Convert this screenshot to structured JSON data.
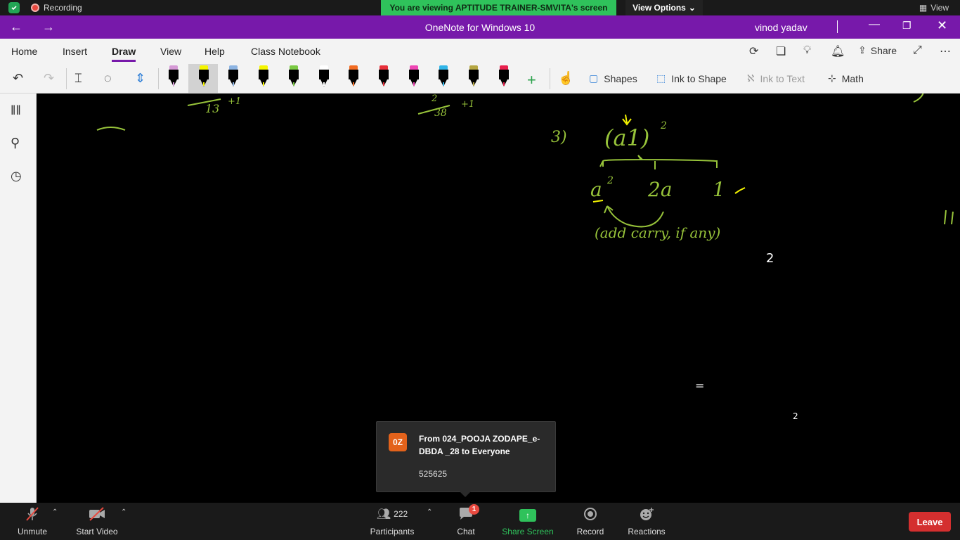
{
  "zoom": {
    "recording_label": "Recording",
    "viewing_banner": "You are viewing APTITUDE TRAINER-SMVITA's screen",
    "view_options_label": "View Options",
    "view_label": "View"
  },
  "titlebar": {
    "title": "OneNote for Windows 10",
    "user": "vinod yadav"
  },
  "menu": {
    "tabs": [
      {
        "label": "Home"
      },
      {
        "label": "Insert"
      },
      {
        "label": "Draw"
      },
      {
        "label": "View"
      },
      {
        "label": "Help"
      },
      {
        "label": "Class Notebook"
      }
    ],
    "active_tab": "Draw",
    "share_label": "Share"
  },
  "ribbon": {
    "shapes_label": "Shapes",
    "ink_to_shape_label": "Ink to Shape",
    "ink_to_text_label": "Ink to Text",
    "math_label": "Math",
    "pens": [
      {
        "color": "#d69ad6"
      },
      {
        "color": "#f5f500"
      },
      {
        "color": "#8db4e2"
      },
      {
        "color": "#f5f500"
      },
      {
        "color": "#7ac943"
      },
      {
        "color": "#ffffff"
      },
      {
        "color": "#f26b21"
      },
      {
        "color": "#e8303a"
      },
      {
        "color": "#ef46b4"
      },
      {
        "color": "#31b5e8"
      },
      {
        "color": "#b5a642"
      },
      {
        "color": "#e8204d"
      }
    ]
  },
  "canvas": {
    "ink": {
      "frac1_num": "13",
      "frac1_plus": "+1",
      "frac2_num": "2",
      "frac2_den": "38",
      "frac2_plus": "+1",
      "step": "3)",
      "expr_base": "(a1)",
      "expr_exp": "2",
      "a_sq_base": "a",
      "a_sq_exp": "2",
      "two_a": "2a",
      "one": "1",
      "note": "(add carry, if any)",
      "white_two": "2",
      "white_equals": "=",
      "white_two_small": "2"
    }
  },
  "chat_popup": {
    "avatar": "0Z",
    "from": "From 024_POOJA ZODAPE_e-DBDA _28 to Everyone",
    "message": "525625"
  },
  "bottombar": {
    "unmute_label": "Unmute",
    "start_video_label": "Start Video",
    "participants_label": "Participants",
    "participants_count": "222",
    "chat_label": "Chat",
    "chat_badge": "1",
    "share_screen_label": "Share Screen",
    "record_label": "Record",
    "reactions_label": "Reactions",
    "leave_label": "Leave"
  }
}
